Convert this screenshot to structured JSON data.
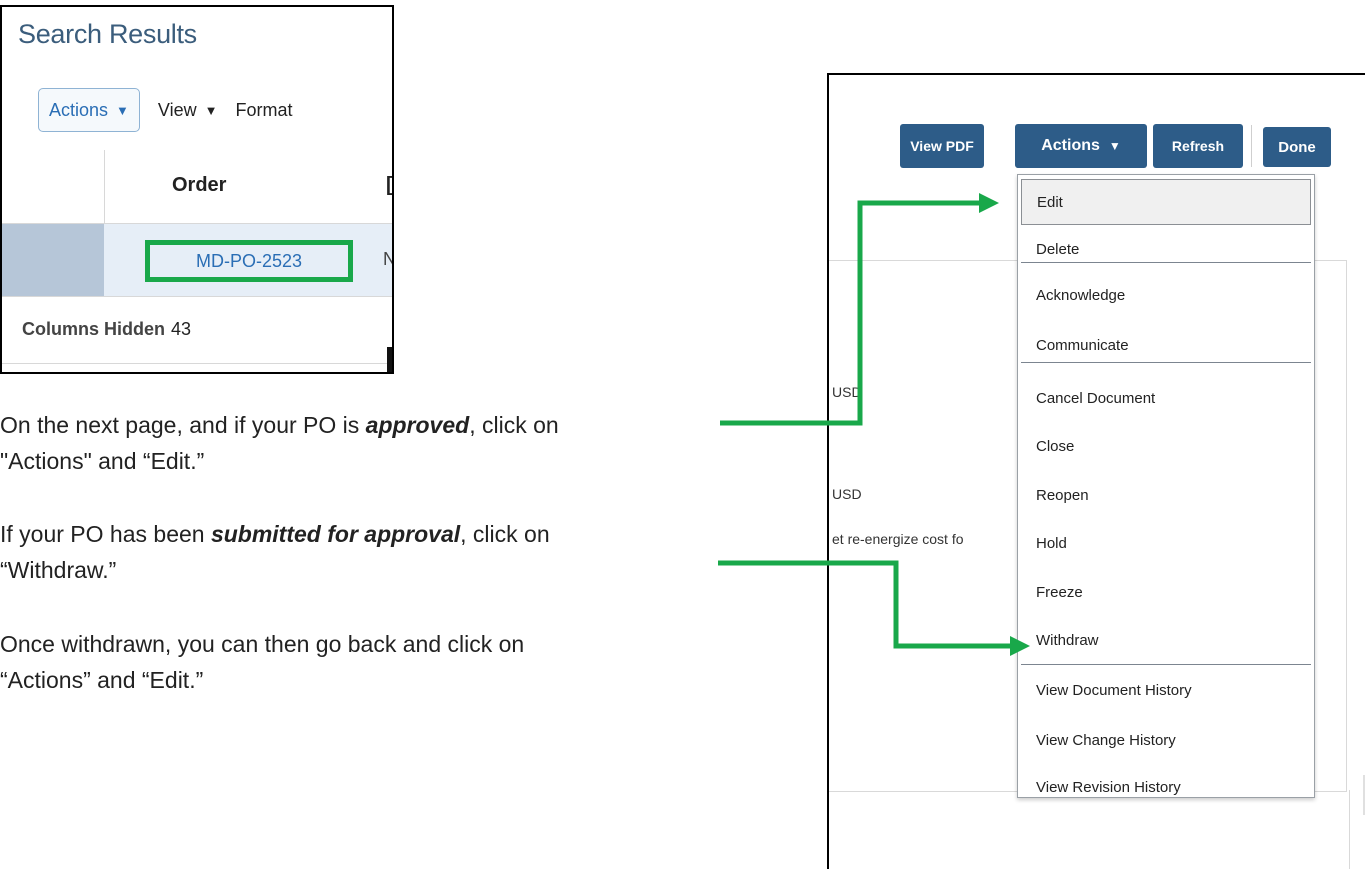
{
  "search_results": {
    "title": "Search Results",
    "toolbar": {
      "actions_label": "Actions",
      "view_label": "View",
      "format_label": "Format"
    },
    "columns": {
      "order_header": "Order",
      "next_header_partial": "["
    },
    "row": {
      "order_value": "MD-PO-2523",
      "next_cell_partial": "N"
    },
    "footer": {
      "label": "Columns Hidden",
      "value": "43"
    }
  },
  "instructions": {
    "line1_pre": "On the next page, and if your PO is ",
    "line1_em": "approved",
    "line1_post": ", click on",
    "line2": "\"Actions\" and “Edit.”",
    "line3_pre": "If your PO has been ",
    "line3_em": "submitted for approval",
    "line3_post": ", click on",
    "line4": "“Withdraw.”",
    "line5": "Once withdrawn, you can then go back and click on",
    "line6": "“Actions” and “Edit.”"
  },
  "po_page": {
    "buttons": {
      "view_pdf": "View PDF",
      "actions": "Actions",
      "refresh": "Refresh",
      "done": "Done"
    },
    "fragments": {
      "usd1": "USD",
      "usd2": "USD",
      "desc_partial": "et re-energize cost fo"
    },
    "menu_items": [
      "Edit",
      "Delete",
      "Acknowledge",
      "Communicate",
      "Cancel Document",
      "Close",
      "Reopen",
      "Hold",
      "Freeze",
      "Withdraw",
      "View Document History",
      "View Change History",
      "View Revision History"
    ]
  },
  "colors": {
    "annotation_green": "#19a84a",
    "button_blue": "#2d5c88",
    "link_blue": "#2a6eb5"
  },
  "icons": [
    "dropdown-triangle-icon",
    "arrow-right-icon"
  ]
}
